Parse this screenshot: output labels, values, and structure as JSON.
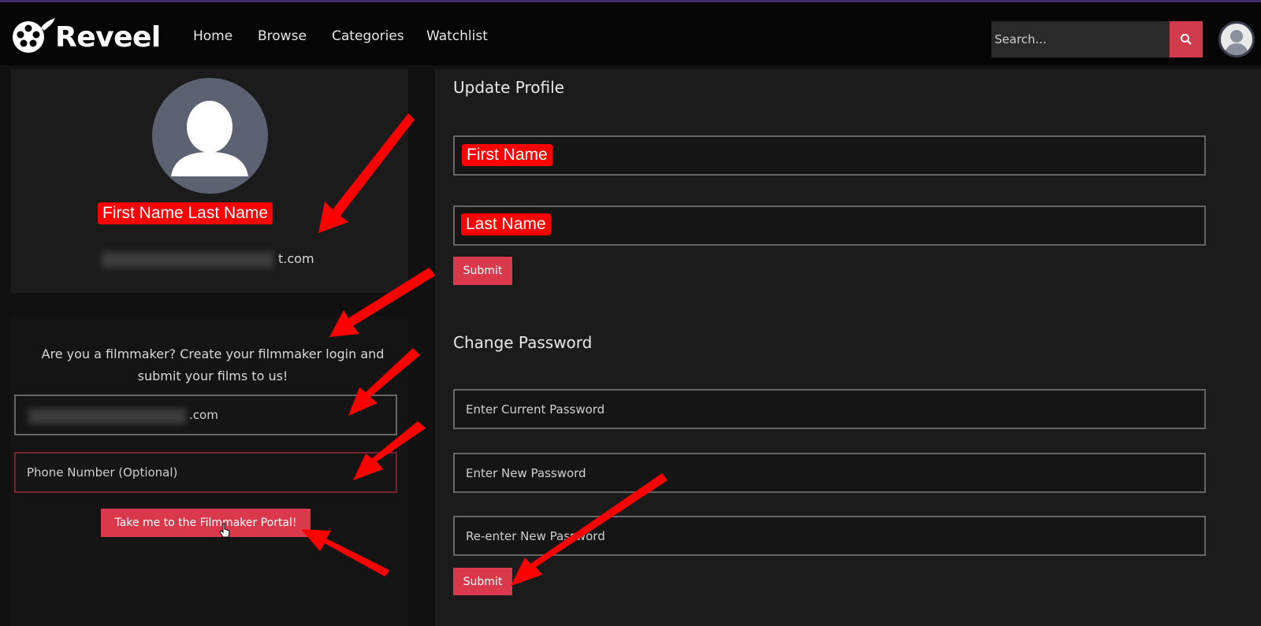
{
  "header": {
    "brand": "Reveel",
    "nav": [
      "Home",
      "Browse",
      "Categories",
      "Watchlist"
    ],
    "search_placeholder": "Search..."
  },
  "profile_card": {
    "name_label": "First Name Last Name",
    "email_suffix": "t.com"
  },
  "filmmaker": {
    "promo_line1": "Are you a filmmaker? Create your filmmaker login and",
    "promo_line2": "submit your films to us!",
    "email_suffix": ".com",
    "phone_placeholder": "Phone Number (Optional)",
    "portal_button": "Take me to the Filmmaker Portal!"
  },
  "update_profile": {
    "title": "Update Profile",
    "first_name_label": "First Name",
    "last_name_label": "Last Name",
    "submit": "Submit"
  },
  "change_password": {
    "title": "Change Password",
    "current_placeholder": "Enter Current Password",
    "new_placeholder": "Enter New Password",
    "reenter_placeholder": "Re-enter New Password",
    "submit": "Submit"
  },
  "colors": {
    "accent": "#d9394b",
    "annotation": "#ff0000",
    "background": "#111111",
    "panel": "#1b1b1b"
  }
}
